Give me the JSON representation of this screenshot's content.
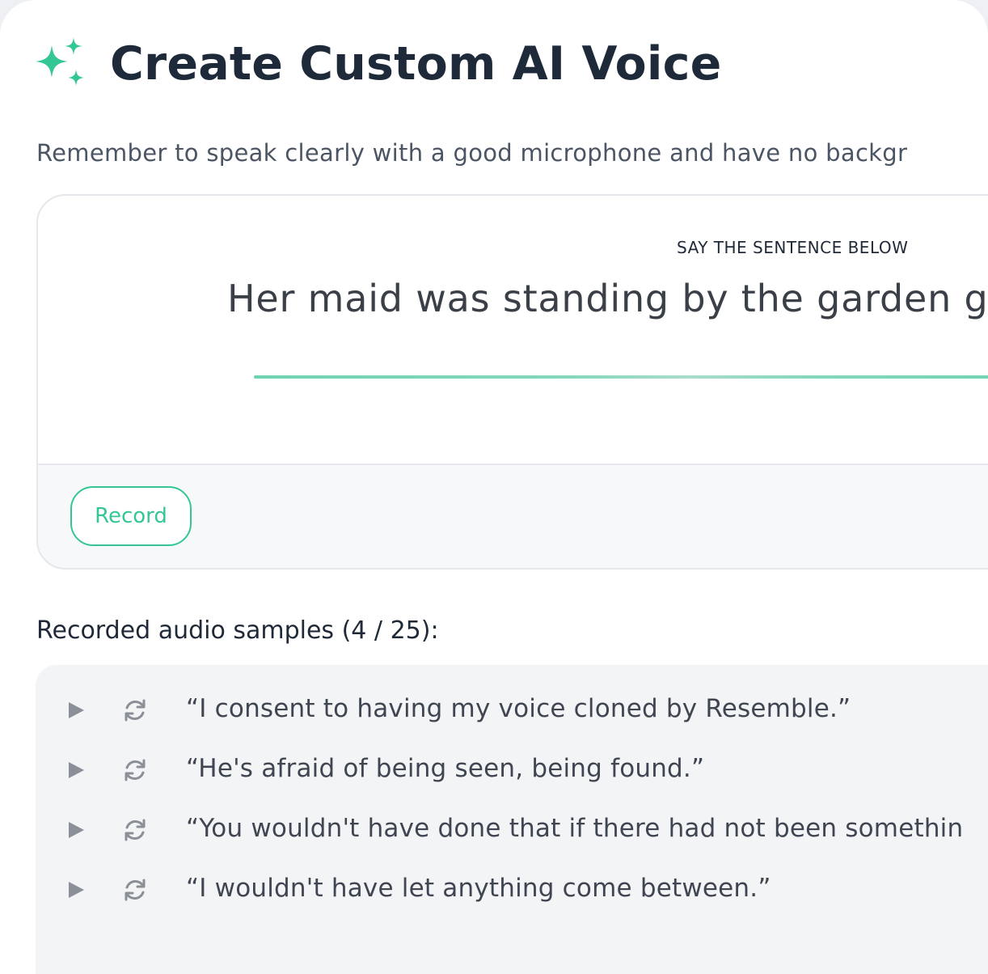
{
  "header": {
    "title": "Create Custom AI Voice",
    "icon": "sparkle-icon",
    "accent_color": "#34c795"
  },
  "instructions": "Remember to speak clearly with a good microphone and have no backgr",
  "recorder": {
    "prompt_label": "SAY THE SENTENCE BELOW",
    "sentence": "Her maid was standing by the garden g",
    "record_label": "Record"
  },
  "samples": {
    "heading": "Recorded audio samples (4 / 25):",
    "items": [
      {
        "text": "“I consent to having my voice cloned by Resemble.”"
      },
      {
        "text": "“He's afraid of being seen, being found.”"
      },
      {
        "text": "“You wouldn't have done that if there had not been somethin"
      },
      {
        "text": "“I wouldn't have let anything come between.”"
      }
    ]
  }
}
